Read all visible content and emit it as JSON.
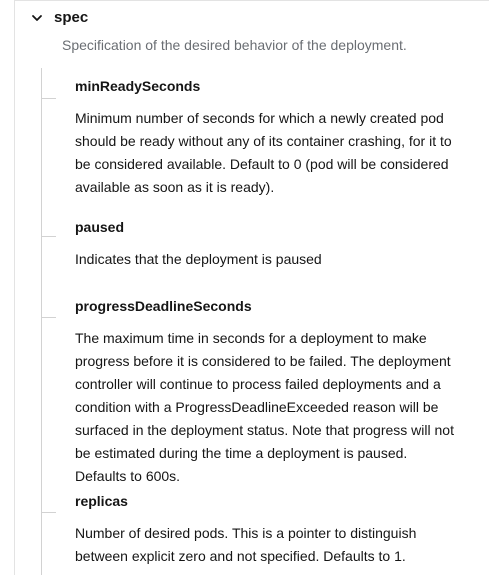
{
  "spec": {
    "title": "spec",
    "description": "Specification of the desired behavior of the deployment."
  },
  "fields": [
    {
      "name": "minReadySeconds",
      "description": "Minimum number of seconds for which a newly created pod should be ready without any of its container crashing, for it to be considered available. Default to 0 (pod will be considered available as soon as it is ready)."
    },
    {
      "name": "paused",
      "description": "Indicates that the deployment is paused"
    },
    {
      "name": "progressDeadlineSeconds",
      "description": "The maximum time in seconds for a deployment to make progress before it is considered to be failed. The deployment controller will continue to process failed deployments and a condition with a ProgressDeadlineExceeded reason will be surfaced in the deployment status. Note that progress will not be estimated during the time a deployment is paused. Defaults to 600s."
    },
    {
      "name": "replicas",
      "description": "Number of desired pods. This is a pointer to distinguish between explicit zero and not specified. Defaults to 1."
    }
  ],
  "icons": {
    "spec_toggle": "chevron-down-icon"
  }
}
